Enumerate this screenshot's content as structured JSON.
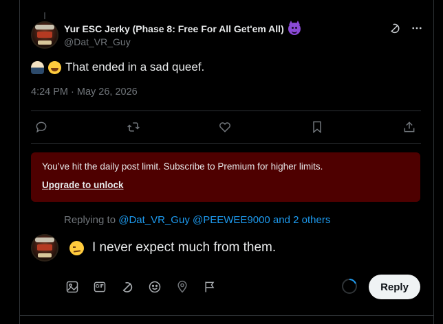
{
  "post": {
    "author_name": "Yur ESC Jerky (Phase 8: Free For All Get'em All)",
    "author_handle": "@Dat_VR_Guy",
    "text": "That ended in a sad queef.",
    "timestamp": "4:24 PM · May 26, 2026"
  },
  "limit_banner": {
    "message": "You’ve hit the daily post limit. Subscribe to Premium for higher limits.",
    "link": "Upgrade to unlock"
  },
  "reply_composer": {
    "replying_prefix": "Replying to",
    "replying_targets": "@Dat_VR_Guy @PEEWEE9000 and 2 others",
    "draft_text": "I never expect much from them.",
    "reply_button": "Reply",
    "gif_label": "GIF"
  },
  "colors": {
    "background": "#000000",
    "accent_blue": "#1d9bf0",
    "banner_red": "#4e0000",
    "muted_text": "#71767b",
    "reply_button_bg": "#eff3f4"
  },
  "icons": {
    "post_actions": [
      "reply-icon",
      "repost-icon",
      "like-icon",
      "bookmark-icon",
      "share-icon"
    ],
    "composer_tools": [
      "image-icon",
      "gif-icon",
      "grok-icon",
      "emoji-icon",
      "location-icon",
      "flag-icon"
    ]
  }
}
